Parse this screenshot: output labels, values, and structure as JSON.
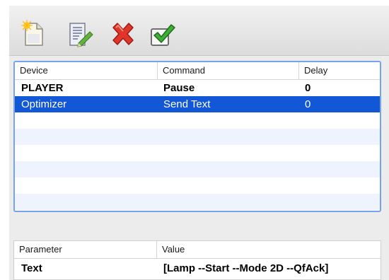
{
  "toolbar": {
    "buttons": [
      {
        "name": "new",
        "icon": "new-document-icon"
      },
      {
        "name": "edit",
        "icon": "edit-document-icon"
      },
      {
        "name": "delete",
        "icon": "red-x-icon"
      },
      {
        "name": "confirm",
        "icon": "green-checkmark-icon"
      }
    ]
  },
  "commands": {
    "columns": [
      "Device",
      "Command",
      "Delay"
    ],
    "rows": [
      {
        "device": "PLAYER",
        "command": "Pause",
        "delay": "0"
      },
      {
        "device": "Optimizer",
        "command": "Send Text",
        "delay": "0"
      }
    ],
    "selected_row": 1
  },
  "parameters": {
    "columns": [
      "Parameter",
      "Value"
    ],
    "rows": [
      {
        "parameter": "Text",
        "value": "[Lamp --Start --Mode 2D --QfAck]"
      }
    ]
  },
  "colors": {
    "selection": "#1257d6",
    "focus_border": "#76a3ea",
    "row_stripe": "#eef3fd"
  }
}
